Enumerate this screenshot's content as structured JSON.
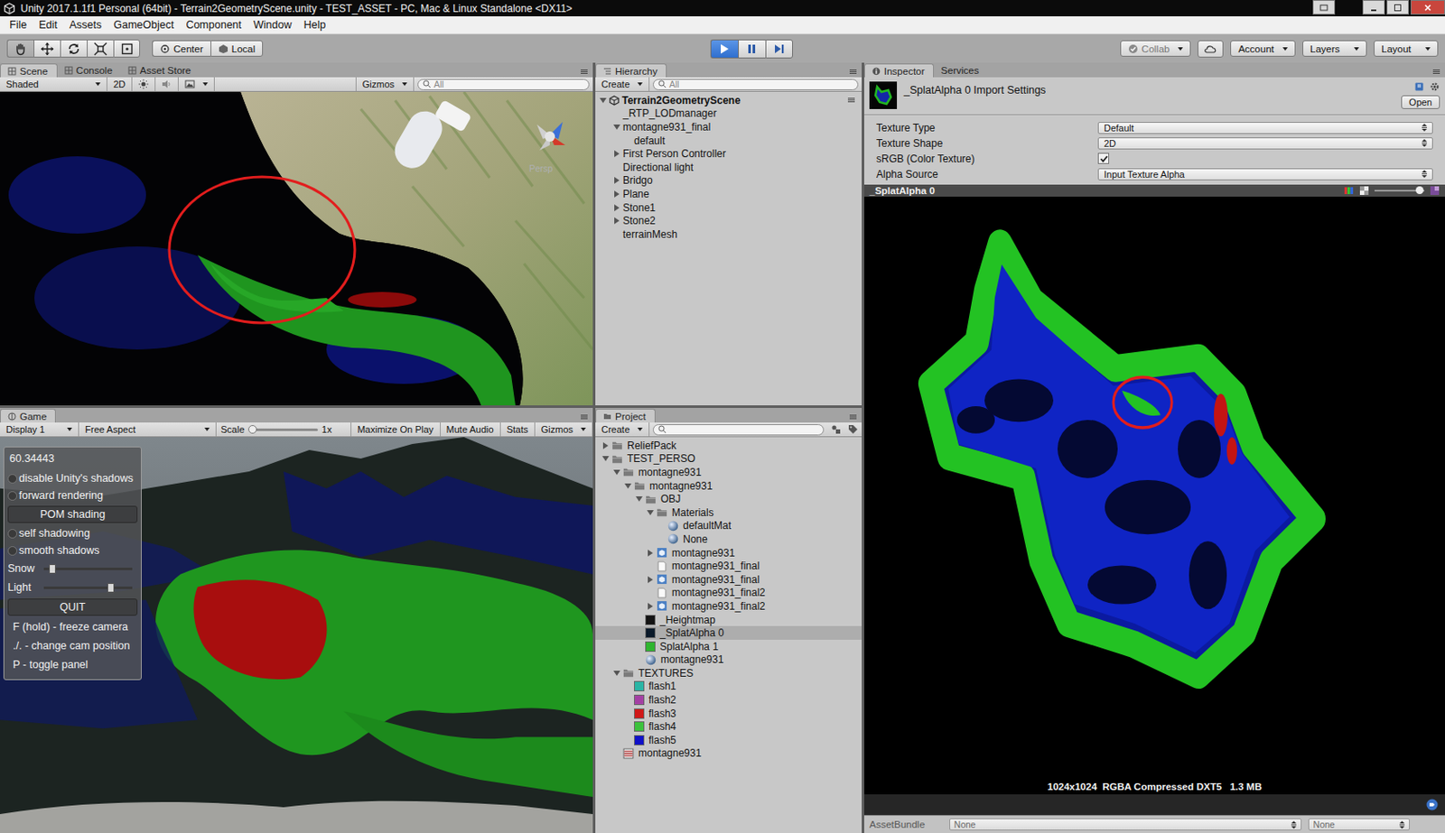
{
  "window": {
    "title": "Unity 2017.1.1f1 Personal (64bit) - Terrain2GeometryScene.unity - TEST_ASSET - PC, Mac & Linux Standalone <DX11>"
  },
  "menu": [
    "File",
    "Edit",
    "Assets",
    "GameObject",
    "Component",
    "Window",
    "Help"
  ],
  "toolbar": {
    "tools": [
      {
        "kind": "hand",
        "selected": true
      },
      {
        "kind": "move",
        "selected": false
      },
      {
        "kind": "rotate",
        "selected": false
      },
      {
        "kind": "scale",
        "selected": false
      },
      {
        "kind": "rect",
        "selected": false
      }
    ],
    "pivot": "Center",
    "space": "Local",
    "transport": [
      {
        "kind": "play",
        "on": true
      },
      {
        "kind": "pause",
        "on": false
      },
      {
        "kind": "step",
        "on": false
      }
    ],
    "collab": "Collab",
    "account": "Account",
    "layers": "Layers",
    "layout": "Layout"
  },
  "scene": {
    "tabs": [
      {
        "label": "Scene",
        "selected": true
      },
      {
        "label": "Console",
        "selected": false
      },
      {
        "label": "Asset Store",
        "selected": false
      }
    ],
    "shading": "Shaded",
    "mode_2d": "2D",
    "gizmos": "Gizmos",
    "search": "All",
    "camera": "Persp"
  },
  "game": {
    "tabs": [
      {
        "label": "Game",
        "selected": true
      }
    ],
    "display": "Display 1",
    "aspect": "Free Aspect",
    "scale_label": "Scale",
    "scale_level": 0.05,
    "scale_value": "1x",
    "buttons": [
      "Maximize On Play",
      "Mute Audio",
      "Stats"
    ],
    "gizmos": "Gizmos",
    "overlay": {
      "fps": "60.34443",
      "options": [
        {
          "kind": "toggle",
          "label": "disable Unity's shadows",
          "on": false
        },
        {
          "kind": "toggle",
          "label": "forward rendering",
          "on": false
        },
        {
          "kind": "button",
          "label": "POM shading"
        },
        {
          "kind": "toggle",
          "label": "self shadowing",
          "on": false
        },
        {
          "kind": "toggle",
          "label": "smooth shadows",
          "on": false
        },
        {
          "kind": "slider",
          "label": "Snow",
          "level": 0.1
        },
        {
          "kind": "slider",
          "label": "Light",
          "level": 0.76
        },
        {
          "kind": "button",
          "label": "QUIT"
        }
      ],
      "help": [
        "F (hold) - freeze camera",
        "./. - change cam position",
        "P - toggle panel"
      ]
    }
  },
  "hierarchy": {
    "tab": "Hierarchy",
    "create": "Create",
    "search": "All",
    "scene": {
      "label": "Terrain2GeometryScene",
      "expanded": true
    },
    "items": [
      {
        "label": "_RTP_LODmanager",
        "selected": false
      },
      {
        "label": "montagne931_final",
        "selected": false,
        "expanded": true,
        "children": [
          {
            "label": "default",
            "selected": false
          }
        ]
      },
      {
        "label": "First Person Controller",
        "selected": false,
        "expanded": false,
        "children": []
      },
      {
        "label": "Directional light",
        "selected": false
      },
      {
        "label": "Bridgo",
        "selected": false,
        "expanded": false,
        "children": []
      },
      {
        "label": "Plane",
        "selected": false,
        "expanded": false,
        "children": []
      },
      {
        "label": "Stone1",
        "selected": false,
        "expanded": false,
        "children": []
      },
      {
        "label": "Stone2",
        "selected": false,
        "expanded": false,
        "children": []
      },
      {
        "label": "terrainMesh",
        "selected": false
      }
    ]
  },
  "project": {
    "tab": "Project",
    "create": "Create",
    "items": [
      {
        "label": "ReliefPack",
        "kind": "folder",
        "selected": false,
        "expanded": false,
        "children": []
      },
      {
        "label": "TEST_PERSO",
        "kind": "folder",
        "selected": false,
        "expanded": true,
        "children": [
          {
            "label": "montagne931",
            "kind": "folder",
            "selected": false,
            "expanded": true,
            "children": [
              {
                "label": "montagne931",
                "kind": "folder",
                "selected": false,
                "expanded": true,
                "children": [
                  {
                    "label": "OBJ",
                    "kind": "folder",
                    "selected": false,
                    "expanded": true,
                    "children": [
                      {
                        "label": "Materials",
                        "kind": "folder",
                        "selected": false,
                        "expanded": true,
                        "children": [
                          {
                            "label": "defaultMat",
                            "kind": "material",
                            "selected": false
                          },
                          {
                            "label": "None",
                            "kind": "material",
                            "selected": false
                          }
                        ]
                      },
                      {
                        "label": "montagne931",
                        "kind": "model",
                        "selected": false,
                        "expanded": false,
                        "children": []
                      },
                      {
                        "label": "montagne931_final",
                        "kind": "mesh",
                        "selected": false
                      },
                      {
                        "label": "montagne931_final",
                        "kind": "model",
                        "selected": false,
                        "expanded": false,
                        "children": []
                      },
                      {
                        "label": "montagne931_final2",
                        "kind": "mesh",
                        "selected": false
                      },
                      {
                        "label": "montagne931_final2",
                        "kind": "model",
                        "selected": false,
                        "expanded": false,
                        "children": []
                      }
                    ]
                  },
                  {
                    "label": "_Heightmap",
                    "kind": "texture",
                    "color": "#141414",
                    "selected": false
                  },
                  {
                    "label": "_SplatAlpha 0",
                    "kind": "texture",
                    "color": "#0b1a2a",
                    "selected": true
                  },
                  {
                    "label": "SplatAlpha 1",
                    "kind": "texture",
                    "color": "#2fb52f",
                    "selected": false
                  },
                  {
                    "label": "montagne931",
                    "kind": "material",
                    "selected": false
                  }
                ]
              }
            ]
          },
          {
            "label": "TEXTURES",
            "kind": "folder",
            "selected": false,
            "expanded": true,
            "children": [
              {
                "label": "flash1",
                "kind": "texture",
                "color": "#2ab5a5",
                "selected": false
              },
              {
                "label": "flash2",
                "kind": "texture",
                "color": "#a43fa4",
                "selected": false
              },
              {
                "label": "flash3",
                "kind": "texture",
                "color": "#d01818",
                "selected": false
              },
              {
                "label": "flash4",
                "kind": "texture",
                "color": "#3cc23c",
                "selected": false
              },
              {
                "label": "flash5",
                "kind": "texture",
                "color": "#1010c8",
                "selected": false
              }
            ]
          },
          {
            "label": "montagne931",
            "kind": "picture",
            "selected": false
          }
        ]
      }
    ]
  },
  "inspector": {
    "tabs": [
      {
        "label": "Inspector",
        "selected": true
      },
      {
        "label": "Services",
        "selected": false
      }
    ],
    "title": "_SplatAlpha 0 Import Settings",
    "open": "Open",
    "fields": [
      {
        "label": "Texture Type",
        "kind": "dropdown",
        "value": "Default"
      },
      {
        "label": "Texture Shape",
        "kind": "dropdown",
        "value": "2D"
      },
      {
        "label": "sRGB (Color Texture)",
        "kind": "checkbox",
        "checked": true
      },
      {
        "label": "Alpha Source",
        "kind": "dropdown",
        "value": "Input Texture Alpha"
      }
    ],
    "preview": {
      "title": "_SplatAlpha 0",
      "mip_level": 0.92,
      "info": "1024x1024  RGBA Compressed DXT5   1.3 MB"
    },
    "footer": {
      "label": "AssetBundle",
      "values": [
        "None",
        "None"
      ]
    }
  }
}
